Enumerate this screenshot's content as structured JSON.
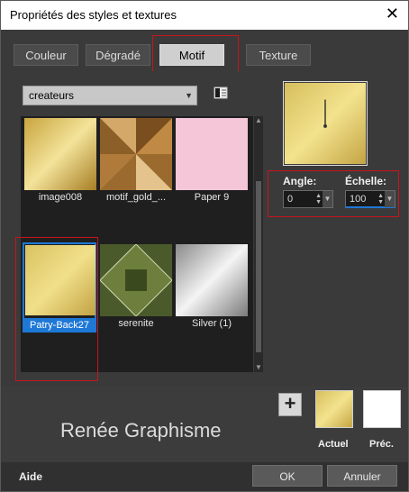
{
  "window": {
    "title": "Propriétés des styles et textures"
  },
  "tabs": [
    {
      "label": "Couleur"
    },
    {
      "label": "Dégradé"
    },
    {
      "label": "Motif"
    },
    {
      "label": "Texture"
    }
  ],
  "category_select": {
    "value": "createurs"
  },
  "patterns": [
    {
      "name": "image008"
    },
    {
      "name": "motif_gold_..."
    },
    {
      "name": "Paper 9"
    },
    {
      "name": "Patry-Back27"
    },
    {
      "name": "serenite"
    },
    {
      "name": "Silver (1)"
    }
  ],
  "controls": {
    "angle_label": "Angle:",
    "angle_value": "0",
    "scale_label": "Échelle:",
    "scale_value": "100"
  },
  "signature": "Renée Graphisme",
  "swatches": {
    "current_label": "Actuel",
    "previous_label": "Préc."
  },
  "footer": {
    "help": "Aide",
    "ok": "OK",
    "cancel": "Annuler"
  },
  "colors": {
    "accent_blue": "#1e78d6",
    "highlight_red": "#c8141e"
  }
}
